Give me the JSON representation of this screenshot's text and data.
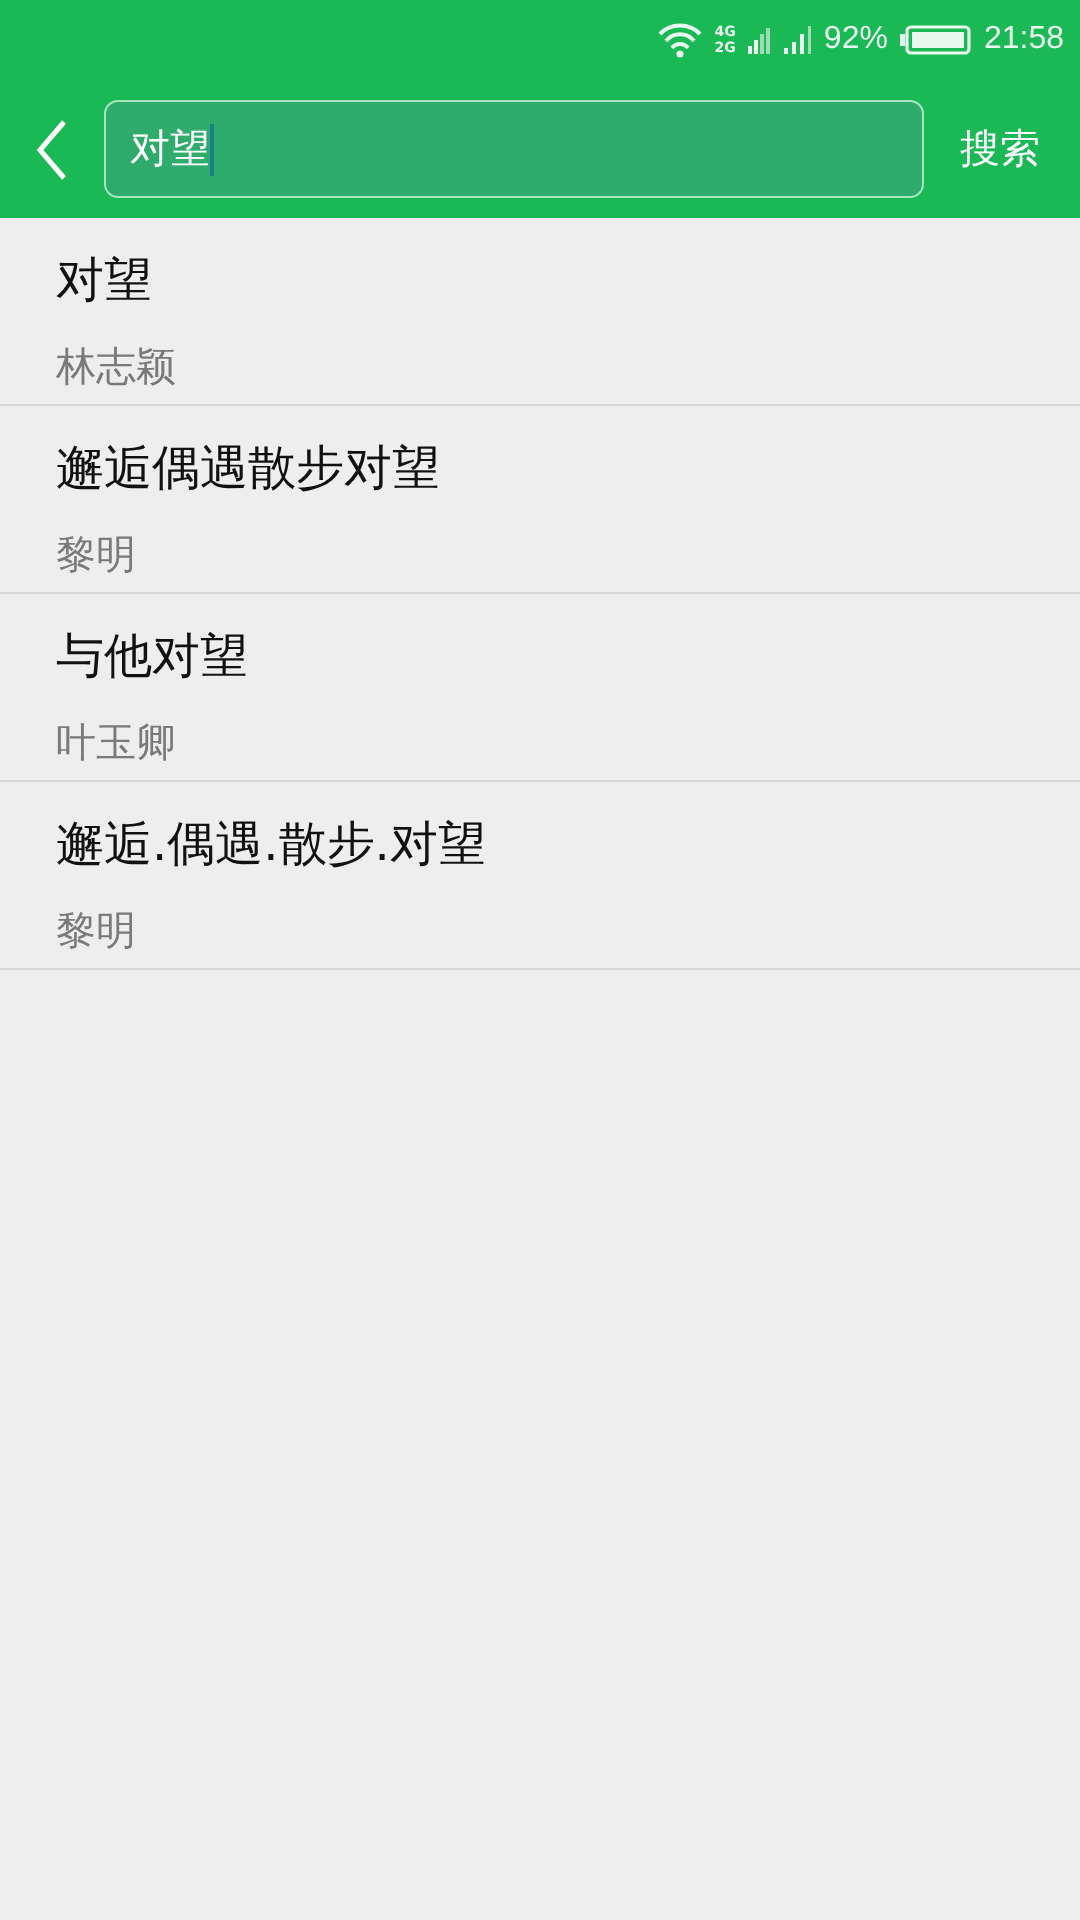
{
  "status_bar": {
    "network_top": "4G",
    "network_bottom": "2G",
    "battery": "92%",
    "time": "21:58"
  },
  "search": {
    "value": "对望",
    "button": "搜索"
  },
  "results": [
    {
      "title": "对望",
      "artist": "林志颖"
    },
    {
      "title": "邂逅偶遇散步对望",
      "artist": "黎明"
    },
    {
      "title": "与他对望",
      "artist": "叶玉卿"
    },
    {
      "title": "邂逅.偶遇.散步.对望",
      "artist": "黎明"
    }
  ]
}
